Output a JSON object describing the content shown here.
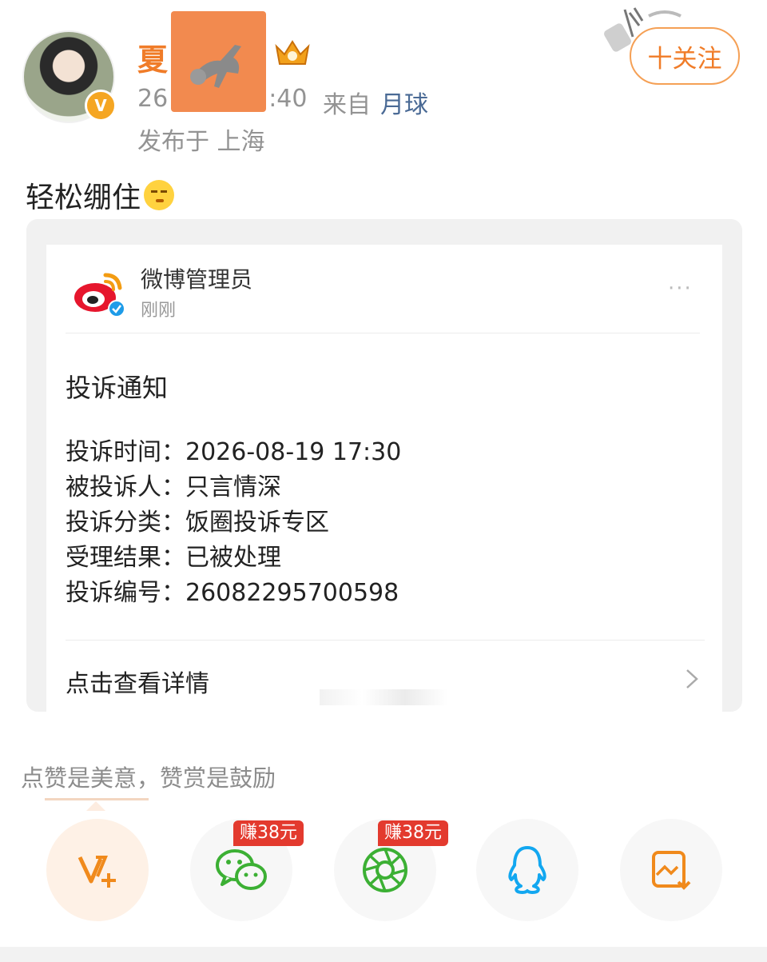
{
  "post": {
    "username": "夏",
    "timestamp_start": "26",
    "timestamp_end": ":40",
    "from_label": "来自",
    "source": "月球",
    "location": "发布于 上海",
    "follow_label": "十关注",
    "text": "轻松绷住"
  },
  "screenshot": {
    "author": "微博管理员",
    "time": "刚刚",
    "notice_title": "投诉通知",
    "fields": [
      {
        "label": "投诉时间：",
        "value": "2026-08-19 17:30"
      },
      {
        "label": "被投诉人：",
        "value": "只言情深"
      },
      {
        "label": "投诉分类：",
        "value": "饭圈投诉专区"
      },
      {
        "label": "受理结果：",
        "value": "已被处理"
      },
      {
        "label": "投诉编号：",
        "value": "26082295700598"
      }
    ],
    "detail_link": "点击查看详情",
    "more": "···"
  },
  "reward": {
    "slogan": "点赞是美意，赞赏是鼓励"
  },
  "share": {
    "wechat_badge": "赚38元",
    "moments_badge": "赚38元"
  },
  "colors": {
    "accent": "#f07c28",
    "badge_red": "#e33a2e",
    "wechat_green": "#3cb034",
    "qq_blue": "#12a7f0"
  }
}
